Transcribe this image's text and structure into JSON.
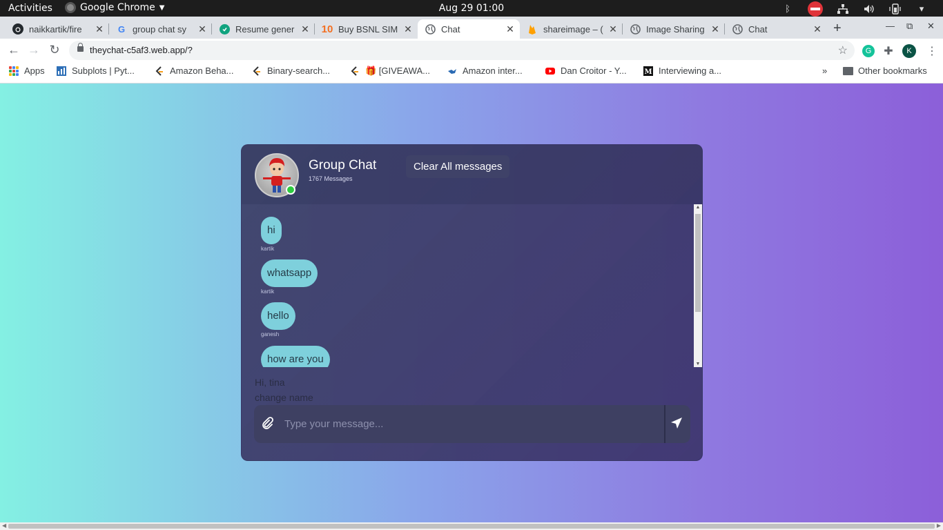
{
  "os_bar": {
    "activities": "Activities",
    "app_name": "Google Chrome",
    "clock": "Aug 29  01:00"
  },
  "tabs": [
    {
      "title": "naikkartik/fire",
      "icon": "github-icon",
      "active": false
    },
    {
      "title": "group chat sy",
      "icon": "google-icon",
      "active": false
    },
    {
      "title": "Resume gener",
      "icon": "resume-site-icon",
      "active": false
    },
    {
      "title": "Buy BSNL SIM",
      "icon": "bsnl-icon",
      "active": false
    },
    {
      "title": "Chat",
      "icon": "globe-icon",
      "active": true
    },
    {
      "title": "shareimage – (",
      "icon": "firebase-icon",
      "active": false
    },
    {
      "title": "Image Sharing",
      "icon": "globe-icon",
      "active": false
    },
    {
      "title": "Chat",
      "icon": "globe-icon",
      "active": false
    }
  ],
  "toolbar": {
    "url": "theychat-c5af3.web.app/?",
    "profile_initial": "K"
  },
  "bookmarks": {
    "items": [
      {
        "label": "Apps",
        "icon": "apps-grid-icon"
      },
      {
        "label": "Subplots | Pyt...",
        "icon": "chart-icon"
      },
      {
        "label": "Amazon Beha...",
        "icon": "leetcode-icon"
      },
      {
        "label": "Binary-search...",
        "icon": "leetcode-icon"
      },
      {
        "label": "🎁 [GIVEAWA...",
        "icon": "leetcode-icon"
      },
      {
        "label": "Amazon inter...",
        "icon": "bird-icon"
      },
      {
        "label": "Dan Croitor - Y...",
        "icon": "youtube-icon"
      },
      {
        "label": "Interviewing a...",
        "icon": "medium-icon"
      }
    ],
    "overflow": "»",
    "other": "Other bookmarks"
  },
  "chat": {
    "title": "Group Chat",
    "message_count": "1767 Messages",
    "clear_label": "Clear All messages",
    "messages": [
      {
        "text": "hi",
        "sender": "kartik"
      },
      {
        "text": "whatsapp",
        "sender": "kartik"
      },
      {
        "text": "hello",
        "sender": "ganesh"
      },
      {
        "text": "how are you",
        "sender": ""
      }
    ],
    "greeting": "Hi, tina",
    "change_name": "change name",
    "input_placeholder": "Type your message..."
  },
  "colors": {
    "bubble": "#7ed0dc",
    "online": "#2ecc40",
    "gradient_start": "#84f0e3",
    "gradient_end": "#8c5fd9"
  }
}
